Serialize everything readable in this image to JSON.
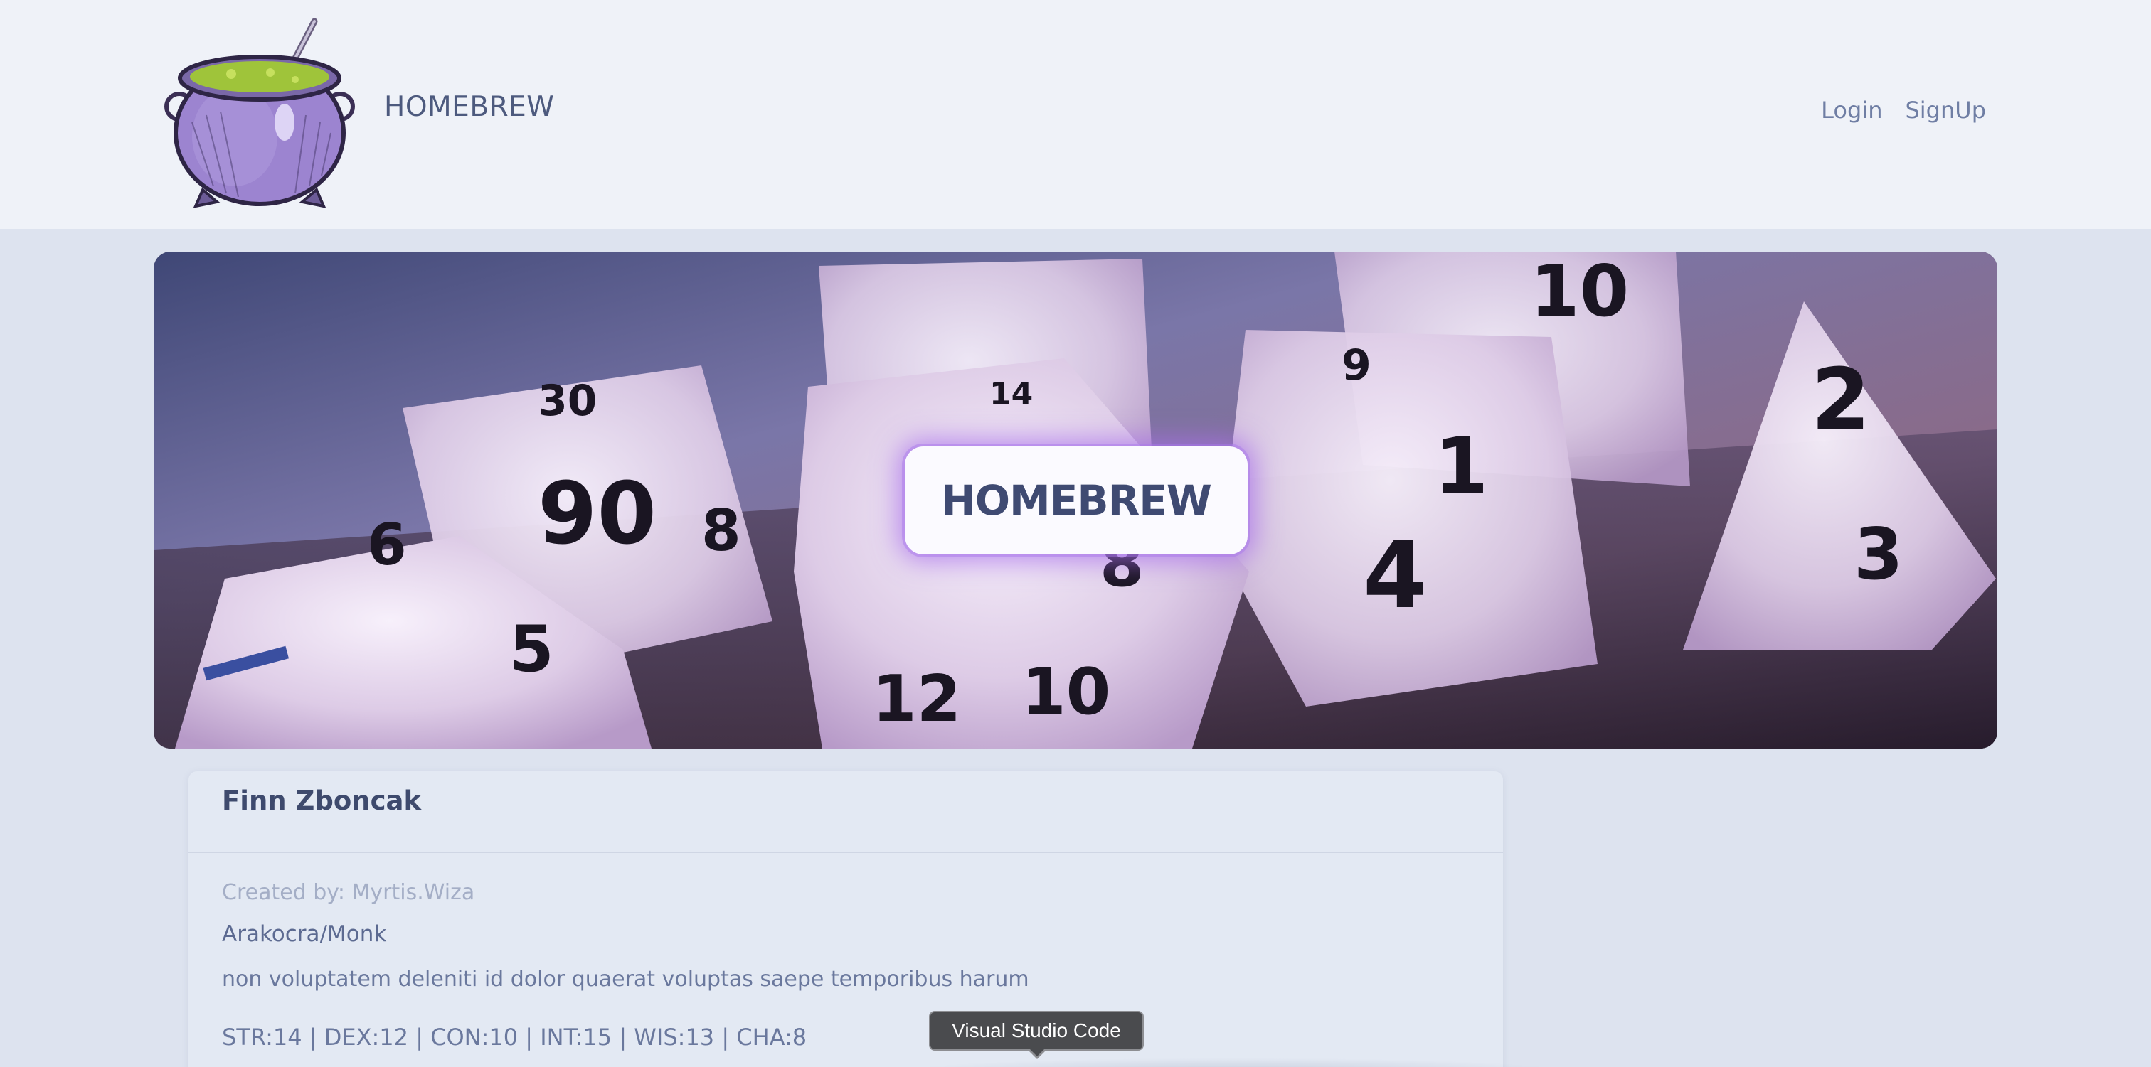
{
  "navbar": {
    "brand": "HOMEBREW",
    "links": [
      {
        "label": "Login"
      },
      {
        "label": "SignUp"
      }
    ]
  },
  "hero": {
    "badge_text": "HOMEBREW",
    "image": "purple-dice-banner"
  },
  "character": {
    "name": "Finn Zboncak",
    "created_by": "Created by: Myrtis.Wiza",
    "race_class": "Arakocra/Monk",
    "description": "non voluptatem deleniti id dolor quaerat voluptas saepe temporibus harum",
    "stats": "STR:14 | DEX:12 | CON:10 | INT:15 | WIS:13 | CHA:8"
  },
  "tooltip": {
    "text": "Visual Studio Code"
  },
  "colors": {
    "page_bg": "#dde3ef",
    "navbar_bg": "#eff2f8",
    "card_bg": "#e3e9f3",
    "badge_glow": "#a86eeb",
    "text_primary": "#3e4a6d",
    "text_muted": "#a4aec6"
  }
}
